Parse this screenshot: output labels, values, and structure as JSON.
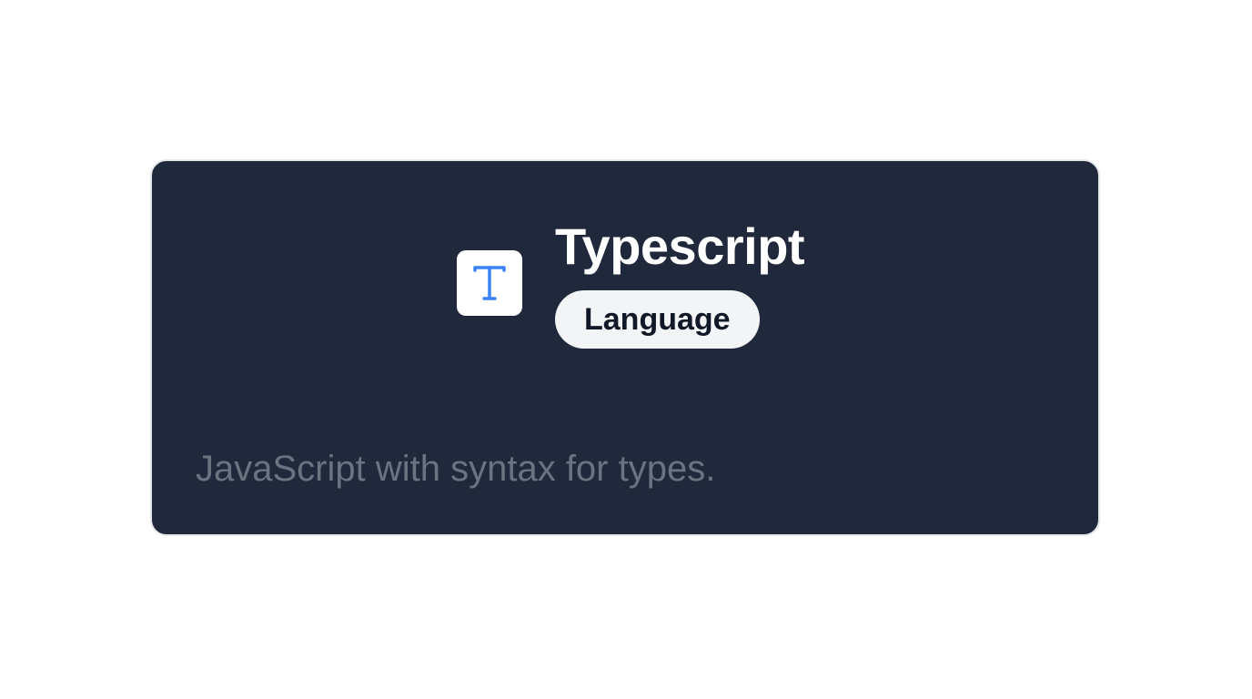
{
  "card": {
    "title": "Typescript",
    "badge": "Language",
    "description": "JavaScript with syntax for types.",
    "icon": "typescript-t-icon"
  },
  "colors": {
    "card_background": "#1f293b",
    "icon_accent": "#3b82f6",
    "badge_background": "#f3f4f6",
    "description_text": "#6b7280"
  }
}
